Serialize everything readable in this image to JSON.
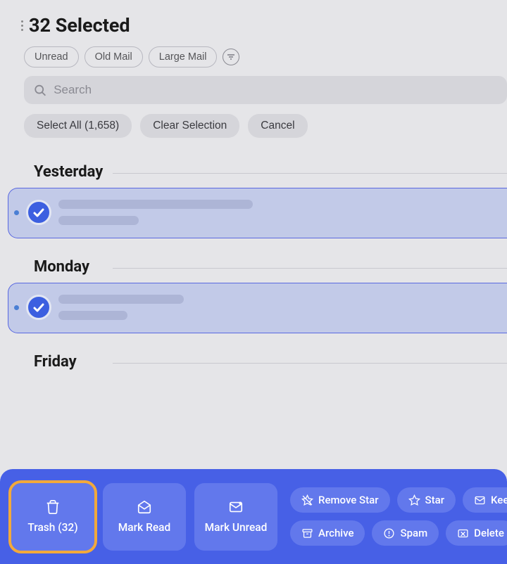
{
  "header": {
    "title": "32 Selected",
    "filters": [
      "Unread",
      "Old Mail",
      "Large Mail"
    ],
    "search_placeholder": "Search",
    "actions": {
      "select_all": "Select All (1,658)",
      "clear": "Clear Selection",
      "cancel": "Cancel"
    }
  },
  "sections": [
    {
      "label": "Yesterday",
      "line1_width": 276,
      "line2_width": 114
    },
    {
      "label": "Monday",
      "line1_width": 178,
      "line2_width": 98
    },
    {
      "label": "Friday",
      "line1_width": 0,
      "line2_width": 0
    }
  ],
  "toolbar": {
    "trash": "Trash (32)",
    "mark_read": "Mark Read",
    "mark_unread": "Mark Unread",
    "remove_star": "Remove Star",
    "star": "Star",
    "keep": "Kee",
    "archive": "Archive",
    "spam": "Spam",
    "delete": "Delete"
  }
}
